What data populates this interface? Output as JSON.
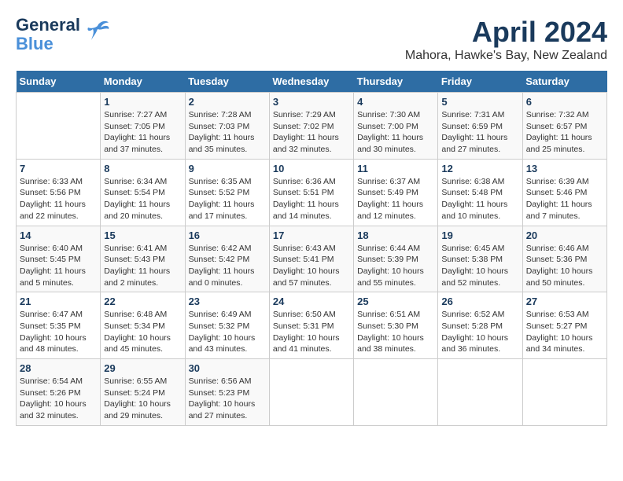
{
  "header": {
    "logo_general": "General",
    "logo_blue": "Blue",
    "month_title": "April 2024",
    "subtitle": "Mahora, Hawke's Bay, New Zealand"
  },
  "calendar": {
    "weekdays": [
      "Sunday",
      "Monday",
      "Tuesday",
      "Wednesday",
      "Thursday",
      "Friday",
      "Saturday"
    ],
    "weeks": [
      [
        {
          "day": "",
          "text": ""
        },
        {
          "day": "1",
          "text": "Sunrise: 7:27 AM\nSunset: 7:05 PM\nDaylight: 11 hours\nand 37 minutes."
        },
        {
          "day": "2",
          "text": "Sunrise: 7:28 AM\nSunset: 7:03 PM\nDaylight: 11 hours\nand 35 minutes."
        },
        {
          "day": "3",
          "text": "Sunrise: 7:29 AM\nSunset: 7:02 PM\nDaylight: 11 hours\nand 32 minutes."
        },
        {
          "day": "4",
          "text": "Sunrise: 7:30 AM\nSunset: 7:00 PM\nDaylight: 11 hours\nand 30 minutes."
        },
        {
          "day": "5",
          "text": "Sunrise: 7:31 AM\nSunset: 6:59 PM\nDaylight: 11 hours\nand 27 minutes."
        },
        {
          "day": "6",
          "text": "Sunrise: 7:32 AM\nSunset: 6:57 PM\nDaylight: 11 hours\nand 25 minutes."
        }
      ],
      [
        {
          "day": "7",
          "text": "Sunrise: 6:33 AM\nSunset: 5:56 PM\nDaylight: 11 hours\nand 22 minutes."
        },
        {
          "day": "8",
          "text": "Sunrise: 6:34 AM\nSunset: 5:54 PM\nDaylight: 11 hours\nand 20 minutes."
        },
        {
          "day": "9",
          "text": "Sunrise: 6:35 AM\nSunset: 5:52 PM\nDaylight: 11 hours\nand 17 minutes."
        },
        {
          "day": "10",
          "text": "Sunrise: 6:36 AM\nSunset: 5:51 PM\nDaylight: 11 hours\nand 14 minutes."
        },
        {
          "day": "11",
          "text": "Sunrise: 6:37 AM\nSunset: 5:49 PM\nDaylight: 11 hours\nand 12 minutes."
        },
        {
          "day": "12",
          "text": "Sunrise: 6:38 AM\nSunset: 5:48 PM\nDaylight: 11 hours\nand 10 minutes."
        },
        {
          "day": "13",
          "text": "Sunrise: 6:39 AM\nSunset: 5:46 PM\nDaylight: 11 hours\nand 7 minutes."
        }
      ],
      [
        {
          "day": "14",
          "text": "Sunrise: 6:40 AM\nSunset: 5:45 PM\nDaylight: 11 hours\nand 5 minutes."
        },
        {
          "day": "15",
          "text": "Sunrise: 6:41 AM\nSunset: 5:43 PM\nDaylight: 11 hours\nand 2 minutes."
        },
        {
          "day": "16",
          "text": "Sunrise: 6:42 AM\nSunset: 5:42 PM\nDaylight: 11 hours\nand 0 minutes."
        },
        {
          "day": "17",
          "text": "Sunrise: 6:43 AM\nSunset: 5:41 PM\nDaylight: 10 hours\nand 57 minutes."
        },
        {
          "day": "18",
          "text": "Sunrise: 6:44 AM\nSunset: 5:39 PM\nDaylight: 10 hours\nand 55 minutes."
        },
        {
          "day": "19",
          "text": "Sunrise: 6:45 AM\nSunset: 5:38 PM\nDaylight: 10 hours\nand 52 minutes."
        },
        {
          "day": "20",
          "text": "Sunrise: 6:46 AM\nSunset: 5:36 PM\nDaylight: 10 hours\nand 50 minutes."
        }
      ],
      [
        {
          "day": "21",
          "text": "Sunrise: 6:47 AM\nSunset: 5:35 PM\nDaylight: 10 hours\nand 48 minutes."
        },
        {
          "day": "22",
          "text": "Sunrise: 6:48 AM\nSunset: 5:34 PM\nDaylight: 10 hours\nand 45 minutes."
        },
        {
          "day": "23",
          "text": "Sunrise: 6:49 AM\nSunset: 5:32 PM\nDaylight: 10 hours\nand 43 minutes."
        },
        {
          "day": "24",
          "text": "Sunrise: 6:50 AM\nSunset: 5:31 PM\nDaylight: 10 hours\nand 41 minutes."
        },
        {
          "day": "25",
          "text": "Sunrise: 6:51 AM\nSunset: 5:30 PM\nDaylight: 10 hours\nand 38 minutes."
        },
        {
          "day": "26",
          "text": "Sunrise: 6:52 AM\nSunset: 5:28 PM\nDaylight: 10 hours\nand 36 minutes."
        },
        {
          "day": "27",
          "text": "Sunrise: 6:53 AM\nSunset: 5:27 PM\nDaylight: 10 hours\nand 34 minutes."
        }
      ],
      [
        {
          "day": "28",
          "text": "Sunrise: 6:54 AM\nSunset: 5:26 PM\nDaylight: 10 hours\nand 32 minutes."
        },
        {
          "day": "29",
          "text": "Sunrise: 6:55 AM\nSunset: 5:24 PM\nDaylight: 10 hours\nand 29 minutes."
        },
        {
          "day": "30",
          "text": "Sunrise: 6:56 AM\nSunset: 5:23 PM\nDaylight: 10 hours\nand 27 minutes."
        },
        {
          "day": "",
          "text": ""
        },
        {
          "day": "",
          "text": ""
        },
        {
          "day": "",
          "text": ""
        },
        {
          "day": "",
          "text": ""
        }
      ]
    ]
  }
}
